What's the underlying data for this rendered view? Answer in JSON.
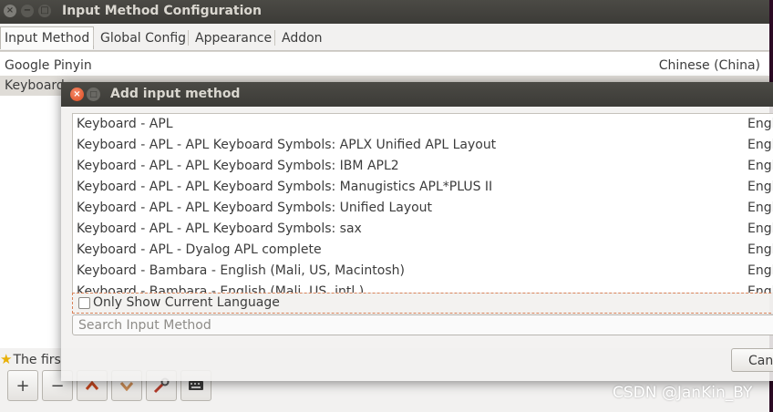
{
  "main_window": {
    "title": "Input Method Configuration",
    "tabs": [
      {
        "label": "Input Method",
        "active": true
      },
      {
        "label": "Global Config",
        "active": false
      },
      {
        "label": "Appearance",
        "active": false
      },
      {
        "label": "Addon",
        "active": false
      }
    ],
    "input_methods": [
      {
        "name": "Google Pinyin",
        "language": "Chinese (China)"
      },
      {
        "name": "Keyboard",
        "language": ""
      }
    ],
    "hint_text": "The firs",
    "toolbar": {
      "add_symbol": "+",
      "remove_symbol": "−"
    }
  },
  "dialog": {
    "title": "Add input method",
    "methods": [
      {
        "name": "Keyboard - APL",
        "language": "Engl"
      },
      {
        "name": "Keyboard - APL - APL Keyboard Symbols: APLX Unified APL Layout",
        "language": "Engl"
      },
      {
        "name": "Keyboard - APL - APL Keyboard Symbols: IBM APL2",
        "language": "Engl"
      },
      {
        "name": "Keyboard - APL - APL Keyboard Symbols: Manugistics APL*PLUS II",
        "language": "Engl"
      },
      {
        "name": "Keyboard - APL - APL Keyboard Symbols: Unified Layout",
        "language": "Engl"
      },
      {
        "name": "Keyboard - APL - APL Keyboard Symbols: sax",
        "language": "Engl"
      },
      {
        "name": "Keyboard - APL - Dyalog APL complete",
        "language": "Engl"
      },
      {
        "name": "Keyboard - Bambara - English (Mali, US, Macintosh)",
        "language": "Engl"
      },
      {
        "name": "Keyboard - Bambara - English (Mali, US, intl.)",
        "language": "Engl"
      }
    ],
    "only_show_current_language": {
      "label": "Only Show Current Language",
      "checked": false
    },
    "search_placeholder": "Search Input Method",
    "cancel_label": "Cancel"
  },
  "watermark": "CSDN @JanKin_BY",
  "colors": {
    "titlebar": "#3c3b37",
    "close_button": "#df4a1d",
    "window_bg": "#f2f1f0",
    "desktop": "#2c001e"
  }
}
